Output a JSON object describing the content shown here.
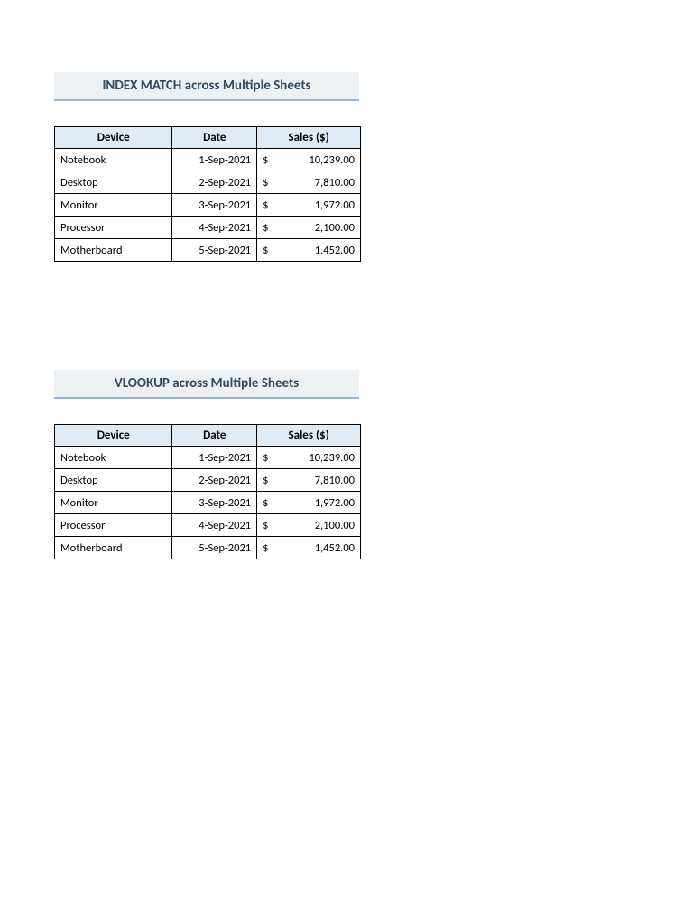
{
  "sections": [
    {
      "title": "INDEX MATCH across Multiple Sheets",
      "headers": {
        "device": "Device",
        "date": "Date",
        "sales": "Sales ($)"
      },
      "currency": "$",
      "rows": [
        {
          "device": "Notebook",
          "date": "1-Sep-2021",
          "sales": "10,239.00"
        },
        {
          "device": "Desktop",
          "date": "2-Sep-2021",
          "sales": "7,810.00"
        },
        {
          "device": "Monitor",
          "date": "3-Sep-2021",
          "sales": "1,972.00"
        },
        {
          "device": "Processor",
          "date": "4-Sep-2021",
          "sales": "2,100.00"
        },
        {
          "device": "Motherboard",
          "date": "5-Sep-2021",
          "sales": "1,452.00"
        }
      ]
    },
    {
      "title": "VLOOKUP across Multiple Sheets",
      "headers": {
        "device": "Device",
        "date": "Date",
        "sales": "Sales ($)"
      },
      "currency": "$",
      "rows": [
        {
          "device": "Notebook",
          "date": "1-Sep-2021",
          "sales": "10,239.00"
        },
        {
          "device": "Desktop",
          "date": "2-Sep-2021",
          "sales": "7,810.00"
        },
        {
          "device": "Monitor",
          "date": "3-Sep-2021",
          "sales": "1,972.00"
        },
        {
          "device": "Processor",
          "date": "4-Sep-2021",
          "sales": "2,100.00"
        },
        {
          "device": "Motherboard",
          "date": "5-Sep-2021",
          "sales": "1,452.00"
        }
      ]
    }
  ]
}
